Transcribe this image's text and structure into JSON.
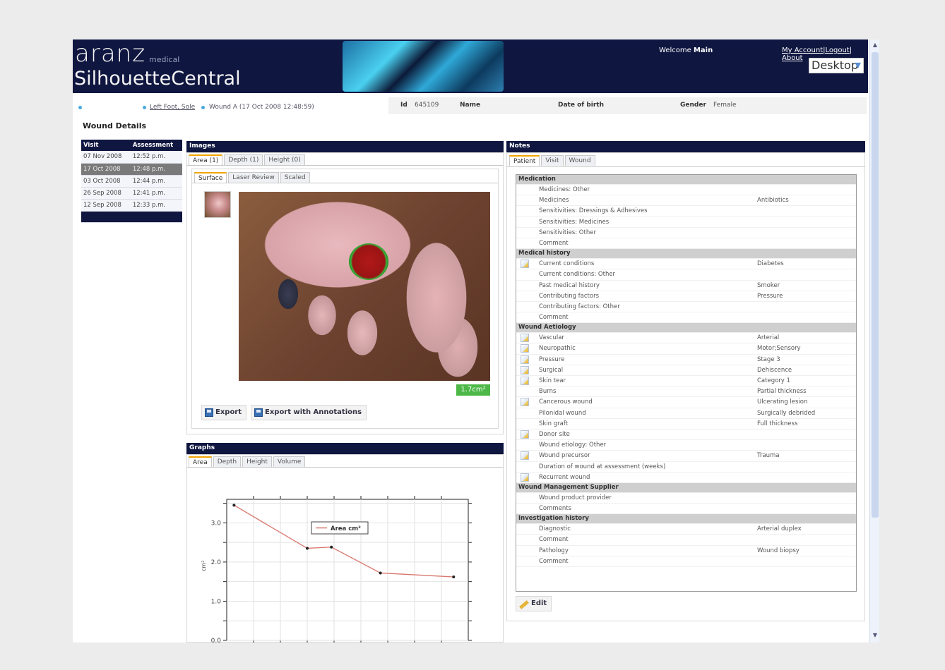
{
  "header": {
    "logo_top": "aranz",
    "logo_medical": "medical",
    "logo_bottom": "SilhouetteCentral",
    "welcome_prefix": "Welcome",
    "welcome_user": "Main",
    "links": "My Account|Logout| About",
    "mode_select": "Desktop"
  },
  "breadcrumb": {
    "link": "Left Foot, Sole",
    "current": "Wound A (17 Oct 2008 12:48:59)"
  },
  "patient": {
    "id_label": "Id",
    "id_value": "645109",
    "name_label": "Name",
    "name_value": "",
    "dob_label": "Date of birth",
    "gender_label": "Gender",
    "gender_value": "Female"
  },
  "page_title": "Wound Details",
  "visits": {
    "headers": [
      "Visit",
      "Assessment"
    ],
    "rows": [
      {
        "date": "07 Nov 2008",
        "time": "12:52 p.m."
      },
      {
        "date": "17 Oct 2008",
        "time": "12:48 p.m.",
        "selected": true
      },
      {
        "date": "03 Oct 2008",
        "time": "12:44 p.m."
      },
      {
        "date": "26 Sep 2008",
        "time": "12:41 p.m."
      },
      {
        "date": "12 Sep 2008",
        "time": "12:33 p.m."
      }
    ]
  },
  "images": {
    "title": "Images",
    "tabs": [
      "Area (1)",
      "Depth (1)",
      "Height (0)"
    ],
    "subtabs": [
      "Surface",
      "Laser Review",
      "Scaled"
    ],
    "area_value": "1.7cm²",
    "export_label": "Export",
    "export_annot_label": "Export with Annotations"
  },
  "graphs": {
    "title": "Graphs",
    "tabs": [
      "Area",
      "Depth",
      "Height",
      "Volume"
    ]
  },
  "notes": {
    "title": "Notes",
    "tabs": [
      "Patient",
      "Visit",
      "Wound"
    ],
    "edit_label": "Edit",
    "rows": [
      {
        "section": "Medication"
      },
      {
        "label": "Medicines: Other",
        "value": ""
      },
      {
        "label": "Medicines",
        "value": "Antibiotics"
      },
      {
        "label": "Sensitivities: Dressings & Adhesives",
        "value": ""
      },
      {
        "label": "Sensitivities: Medicines",
        "value": ""
      },
      {
        "label": "Sensitivities: Other",
        "value": ""
      },
      {
        "label": "Comment",
        "value": ""
      },
      {
        "section": "Medical history"
      },
      {
        "label": "Current conditions",
        "value": "Diabetes",
        "icon": true
      },
      {
        "label": "Current conditions: Other",
        "value": ""
      },
      {
        "label": "Past medical history",
        "value": "Smoker"
      },
      {
        "label": "Contributing factors",
        "value": "Pressure"
      },
      {
        "label": "Contributing factors: Other",
        "value": ""
      },
      {
        "label": "Comment",
        "value": ""
      },
      {
        "section": "Wound Aetiology"
      },
      {
        "label": "Vascular",
        "value": "Arterial",
        "icon": true
      },
      {
        "label": "Neuropathic",
        "value": "Motor;Sensory",
        "icon": true
      },
      {
        "label": "Pressure",
        "value": "Stage 3",
        "icon": true
      },
      {
        "label": "Surgical",
        "value": "Dehiscence",
        "icon": true
      },
      {
        "label": "Skin tear",
        "value": "Category 1",
        "icon": true
      },
      {
        "label": "Burns",
        "value": "Partial thickness"
      },
      {
        "label": "Cancerous wound",
        "value": "Ulcerating lesion",
        "icon": true
      },
      {
        "label": "Pilonidal wound",
        "value": "Surgically debrided"
      },
      {
        "label": "Skin graft",
        "value": "Full thickness"
      },
      {
        "label": "Donor site",
        "value": "",
        "icon": true
      },
      {
        "label": "Wound etiology: Other",
        "value": ""
      },
      {
        "label": "Wound precursor",
        "value": "Trauma",
        "icon": true
      },
      {
        "label": "Duration of wound at assessment (weeks)",
        "value": ""
      },
      {
        "label": "Recurrent wound",
        "value": "",
        "icon": true
      },
      {
        "section": "Wound Management Supplier"
      },
      {
        "label": "Wound product provider",
        "value": ""
      },
      {
        "label": "Comments",
        "value": ""
      },
      {
        "section": "Investigation history"
      },
      {
        "label": "Diagnostic",
        "value": "Arterial duplex"
      },
      {
        "label": "Comment",
        "value": ""
      },
      {
        "label": "Pathology",
        "value": "Wound biopsy"
      },
      {
        "label": "Comment",
        "value": ""
      }
    ]
  },
  "chart_data": {
    "type": "line",
    "series": [
      {
        "name": "Area cm²",
        "values": [
          3.45,
          2.35,
          2.38,
          1.72,
          1.62
        ]
      }
    ],
    "x": [
      0,
      1,
      1.33,
      2,
      3
    ],
    "ylabel": "cm²",
    "ylim": [
      0,
      3.6
    ],
    "yticks": [
      "3.0",
      "2.0",
      "1.0",
      "0.0"
    ],
    "legend_position": "top-center",
    "grid": true
  }
}
